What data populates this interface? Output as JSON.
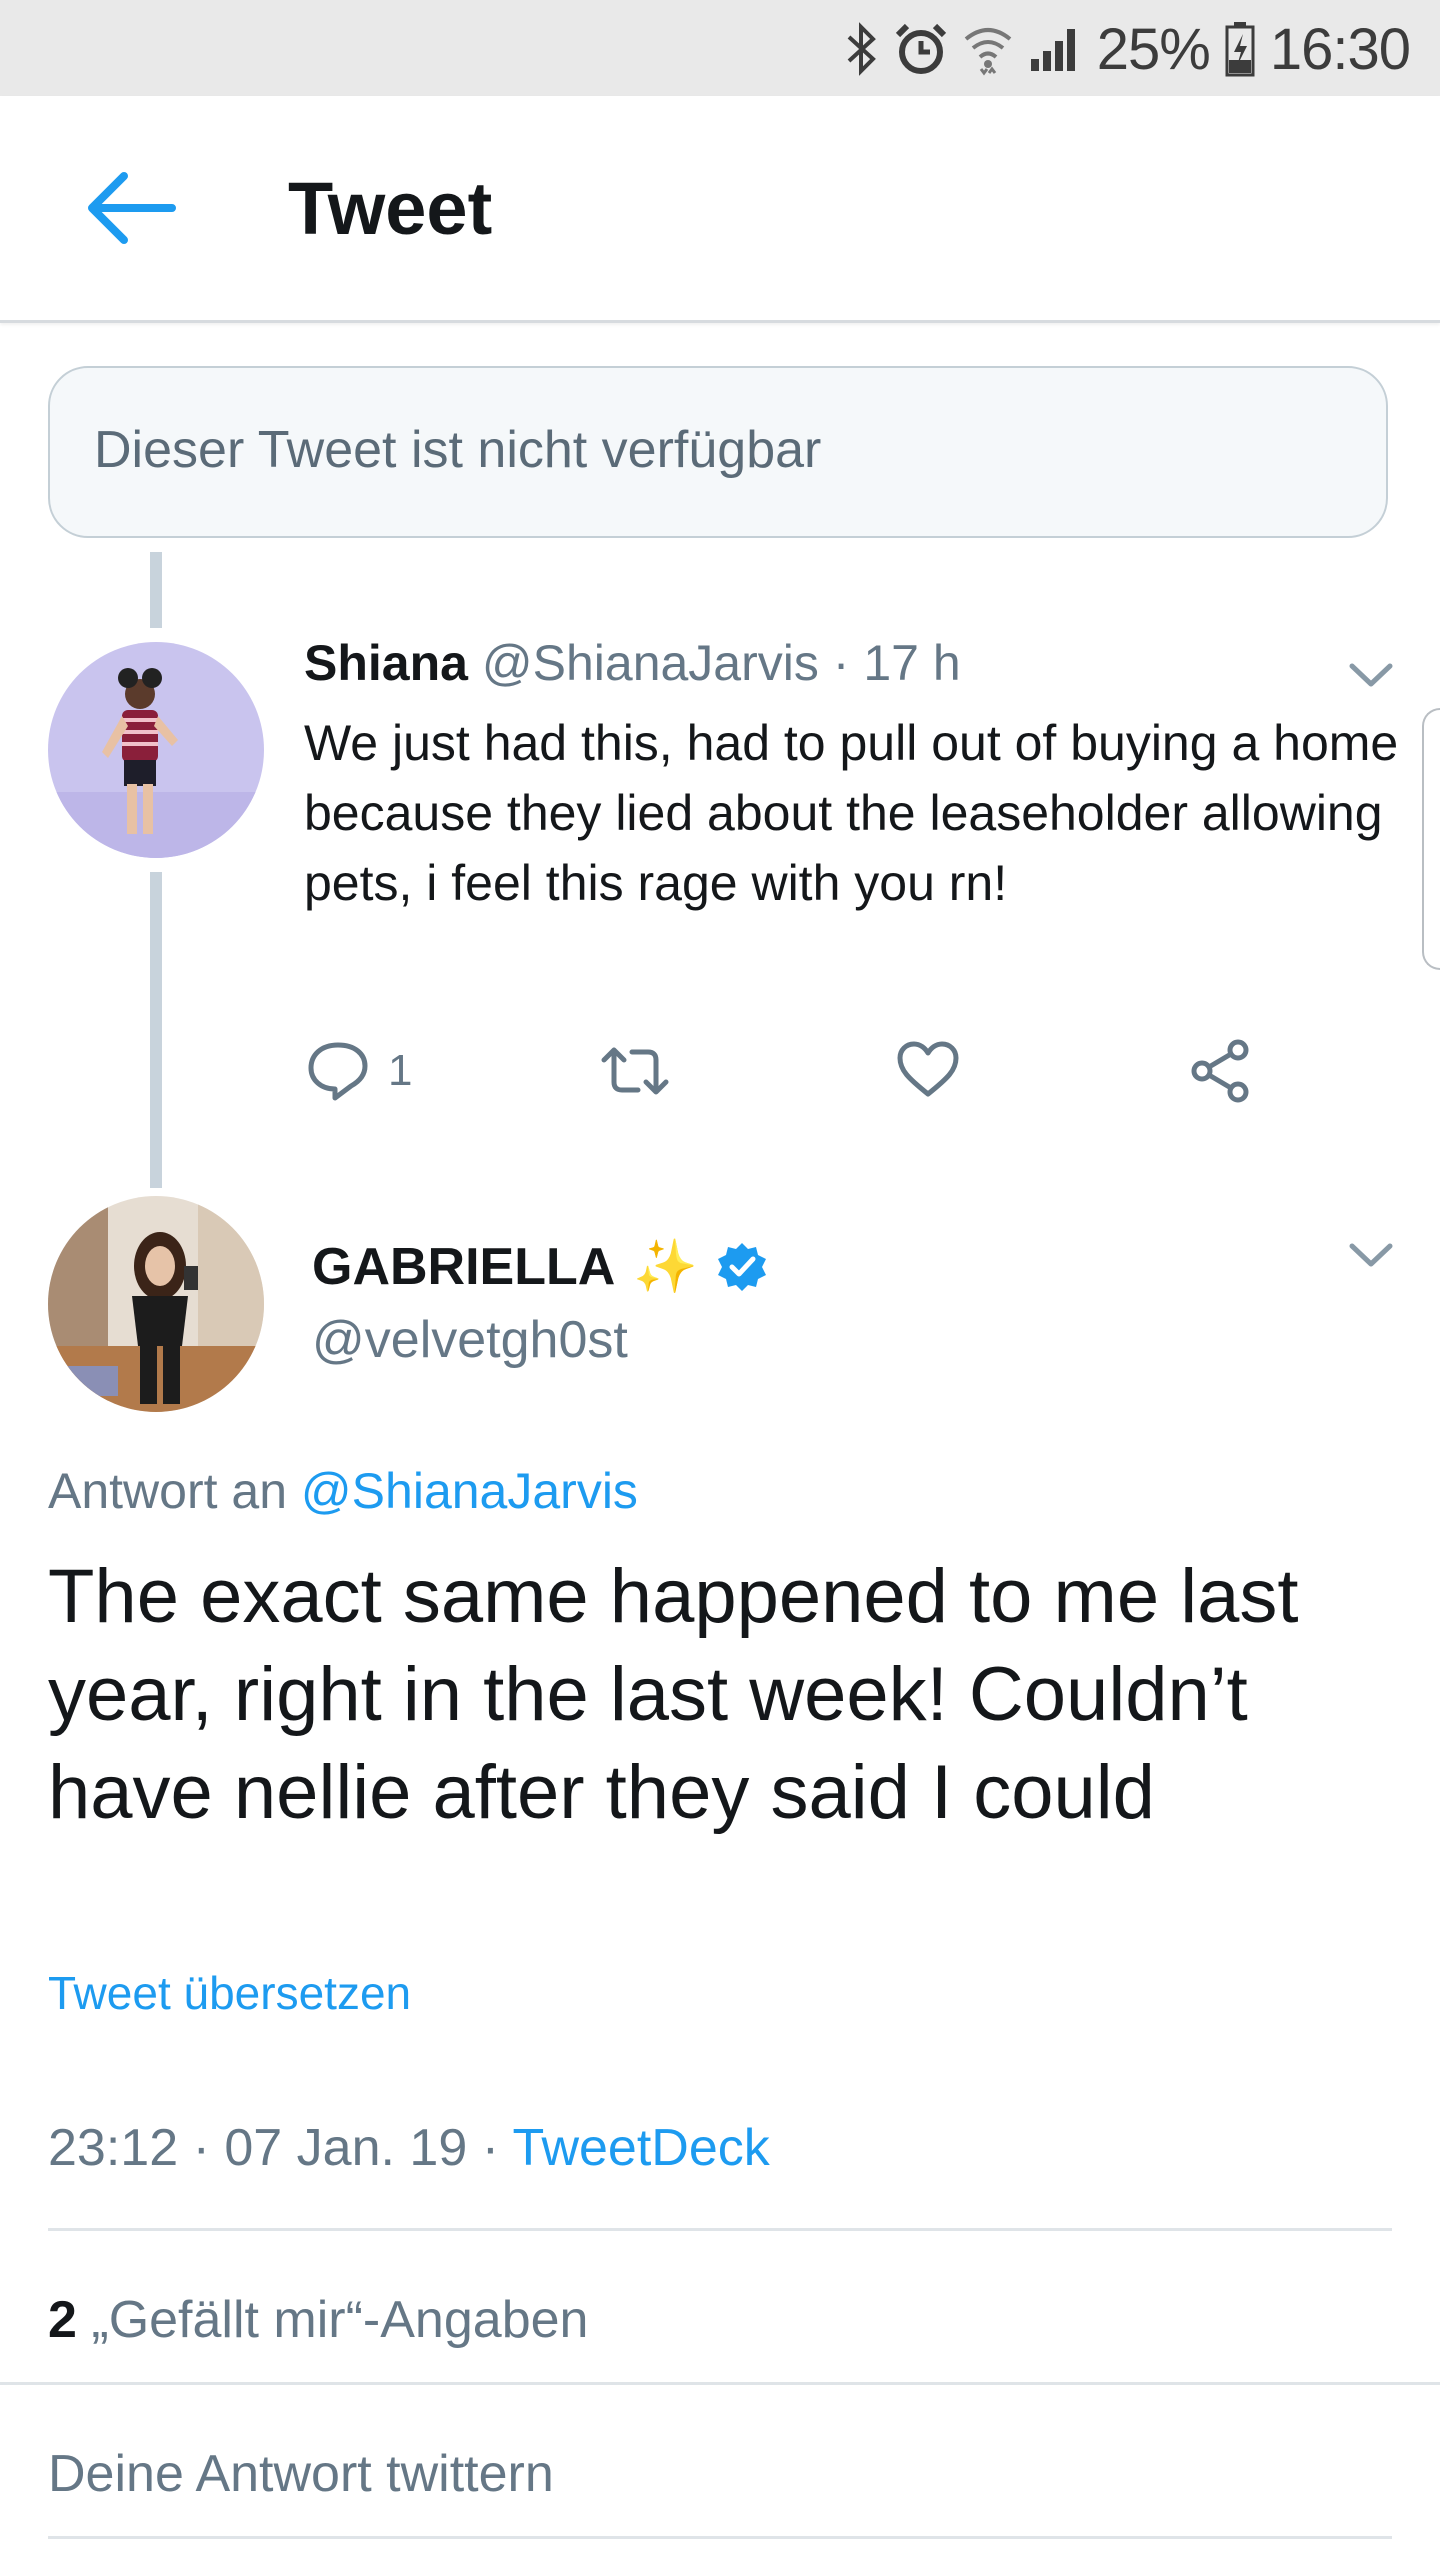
{
  "status_bar": {
    "battery": "25%",
    "time": "16:30"
  },
  "header": {
    "title": "Tweet"
  },
  "unavailable_notice": "Dieser Tweet ist nicht verfügbar",
  "parent_tweet": {
    "name": "Shiana",
    "handle": "@ShianaJarvis",
    "separator": "·",
    "age": "17 h",
    "text": "We just had this, had to pull out of buying a home because they lied about the leaseholder allowing pets, i feel this rage with you rn!",
    "reply_count": "1"
  },
  "main_tweet": {
    "name": "GABRIELLA",
    "emoji": "✨",
    "handle": "@velvetgh0st",
    "reply_prefix": "Antwort an",
    "reply_handle": "@ShianaJarvis",
    "text": "The exact same happened to me last year, right in the last week! Couldn’t have nellie after they said I could",
    "translate_label": "Tweet übersetzen",
    "time": "23:12",
    "sep1": "·",
    "date": "07 Jan. 19",
    "sep2": "·",
    "client": "TweetDeck",
    "likes_count": "2",
    "likes_label": "„Gefällt mir“-Angaben"
  },
  "reply_box": {
    "placeholder": "Deine Antwort twittern"
  },
  "colors": {
    "accent": "#1d9bf0",
    "muted": "#657786",
    "text": "#14171a"
  }
}
